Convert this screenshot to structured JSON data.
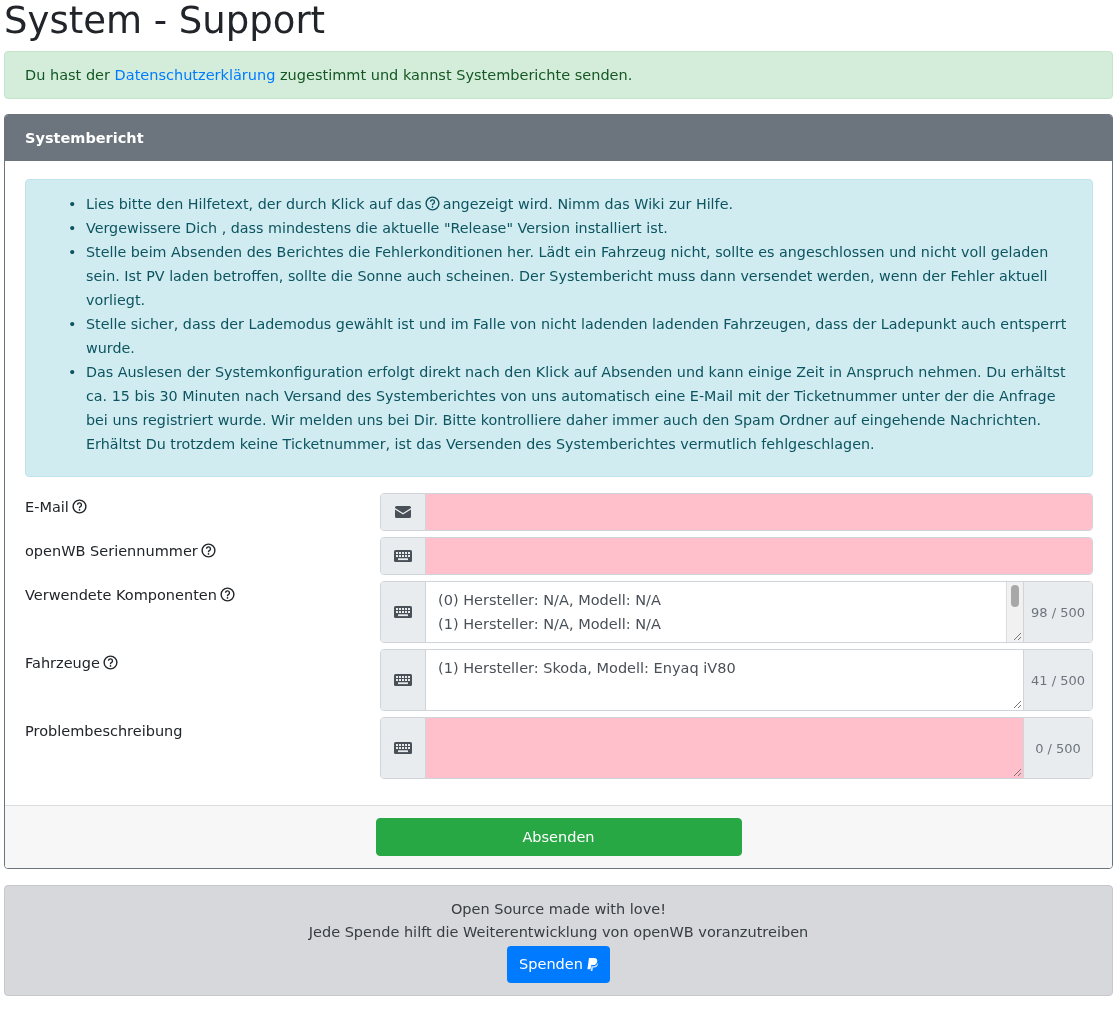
{
  "page_title": "System - Support",
  "consent_alert": {
    "text_before": "Du hast der ",
    "link": "Datenschutzerklärung",
    "text_after": " zugestimmt und kannst Systemberichte senden."
  },
  "card": {
    "header": "Systembericht",
    "instructions": [
      {
        "bullet": "•",
        "text_before": "Lies bitte den Hilfetext, der durch Klick auf das",
        "has_help_icon": true,
        "text_after": "angezeigt wird. Nimm das Wiki zur Hilfe."
      },
      {
        "bullet": "•",
        "text_before": "Vergewissere Dich , dass mindestens die aktuelle \"Release\" Version installiert ist.",
        "has_help_icon": false
      },
      {
        "bullet": "•",
        "text_before": "Stelle beim Absenden des Berichtes die Fehlerkonditionen her. Lädt ein Fahrzeug nicht, sollte es angeschlossen und nicht voll geladen sein. Ist PV laden betroffen, sollte die Sonne auch scheinen. Der Systembericht muss dann versendet werden, wenn der Fehler aktuell vorliegt.",
        "has_help_icon": false
      },
      {
        "bullet": "•",
        "text_before": "Stelle sicher, dass der Lademodus gewählt ist und im Falle von nicht ladenden ladenden Fahrzeugen, dass der Ladepunkt auch entsperrt wurde.",
        "has_help_icon": false
      },
      {
        "bullet": "•",
        "text_before": "Das Auslesen der Systemkonfiguration erfolgt direkt nach den Klick auf Absenden und kann einige Zeit in Anspruch nehmen. Du erhältst ca. 15 bis 30 Minuten nach Versand des Systemberichtes von uns automatisch eine E-Mail mit der Ticketnummer unter der die Anfrage bei uns registriert wurde. Wir melden uns bei Dir. Bitte kontrolliere daher immer auch den Spam Ordner auf eingehende Nachrichten. Erhältst Du trotzdem keine Ticketnummer, ist das Versenden des Systemberichtes vermutlich fehlgeschlagen.",
        "has_help_icon": false
      }
    ],
    "fields": [
      {
        "label": "E-Mail",
        "has_help_icon": true,
        "kind": "email",
        "invalid": true
      },
      {
        "label": "openWB Seriennummer",
        "has_help_icon": true,
        "kind": "input",
        "invalid": true
      },
      {
        "label": "Verwendete Komponenten",
        "has_help_icon": true,
        "kind": "textarea",
        "invalid": false,
        "value": "(0) Hersteller: N/A, Modell: N/A\n(1) Hersteller: N/A, Modell: N/A",
        "scrollable": true,
        "counter": "98 / 500"
      },
      {
        "label": "Fahrzeuge",
        "has_help_icon": true,
        "kind": "textarea",
        "invalid": false,
        "value": "(1) Hersteller: Skoda, Modell: Enyaq iV80",
        "scrollable": false,
        "counter": "41 / 500"
      },
      {
        "label": "Problembeschreibung",
        "has_help_icon": false,
        "kind": "textarea",
        "invalid": true,
        "scrollable": false,
        "counter": "0 / 500"
      }
    ],
    "submit_button": "Absenden"
  },
  "donation_footer": {
    "line_1": "Open Source made with love!",
    "line_2": "Jede Spende hilft die Weiterentwicklung von openWB voranzutreiben",
    "button": "Spenden"
  }
}
